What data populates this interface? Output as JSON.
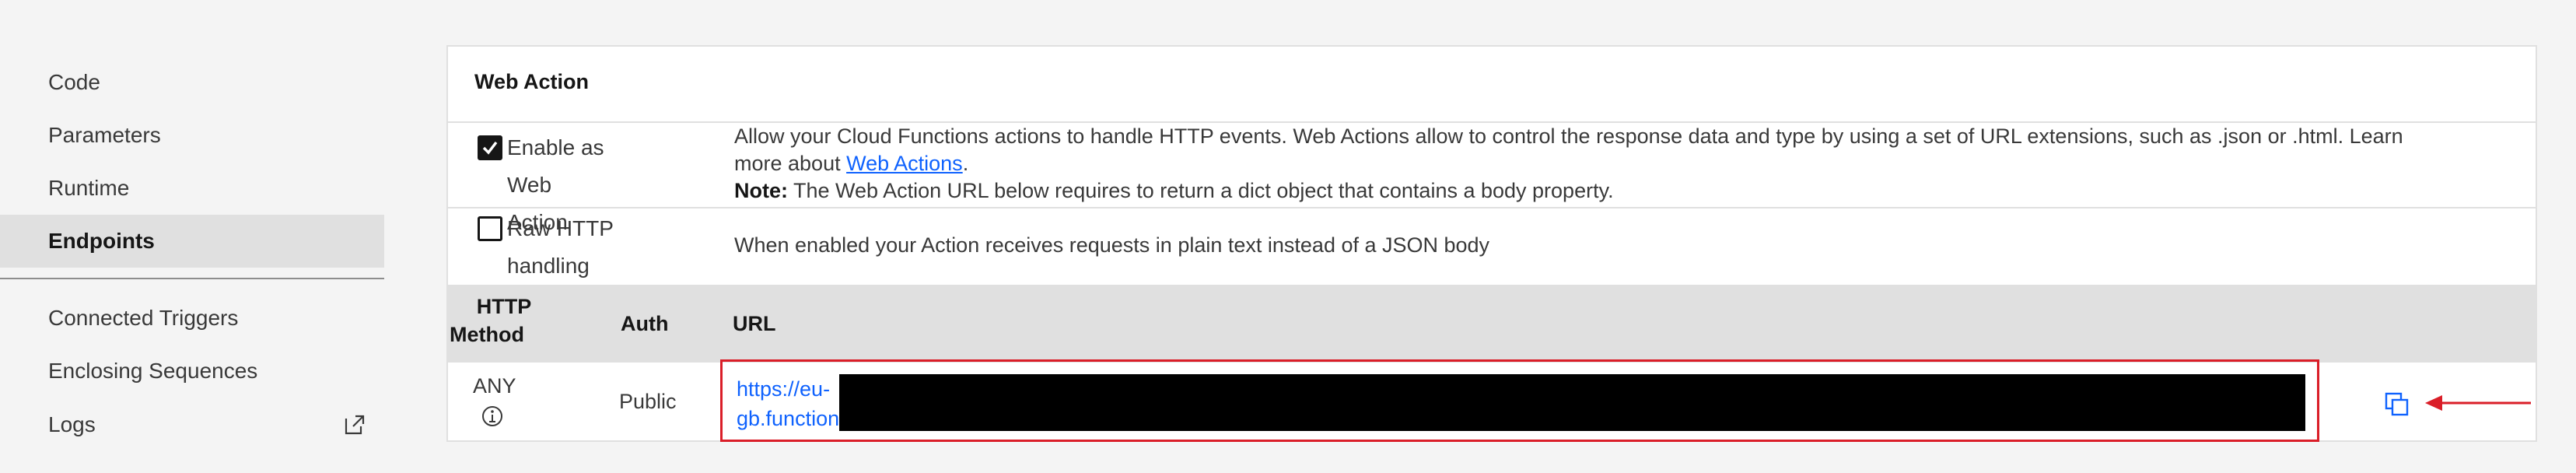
{
  "sidebar": {
    "items": [
      {
        "label": "Code"
      },
      {
        "label": "Parameters"
      },
      {
        "label": "Runtime"
      },
      {
        "label": "Endpoints",
        "active": true
      },
      {
        "label": "Connected Triggers"
      },
      {
        "label": "Enclosing Sequences"
      },
      {
        "label": "Logs",
        "icon": "external-link-icon"
      }
    ]
  },
  "card": {
    "title": "Web Action",
    "options": [
      {
        "label_line1": "Enable as Web",
        "label_line2": "Action",
        "checked": true,
        "desc_line1": "Allow your Cloud Functions actions to handle HTTP events. Web Actions allow to control the response data and type by using a set of URL extensions, such as .json or .html. Learn",
        "desc_more_prefix": "more about ",
        "desc_link": "Web Actions",
        "desc_more_suffix": ".",
        "note_label": "Note:",
        "note_text": " The Web Action URL below requires to return a dict object that contains a body property."
      },
      {
        "label_line1": "Raw HTTP",
        "label_line2": "handling",
        "checked": false,
        "desc": "When enabled your Action receives requests in plain text instead of a JSON body"
      }
    ],
    "table": {
      "headers": {
        "method_line1": "HTTP",
        "method_line2": "Method",
        "auth": "Auth",
        "url": "URL"
      },
      "row": {
        "method": "ANY",
        "auth": "Public",
        "url_line1": "https://eu-",
        "url_line2": "gb.function"
      }
    },
    "icons": {
      "info": "info-icon",
      "copy": "copy-icon",
      "annotation": "red-arrow-icon"
    },
    "colors": {
      "link": "#0f62fe",
      "highlight": "#da1e28"
    }
  }
}
